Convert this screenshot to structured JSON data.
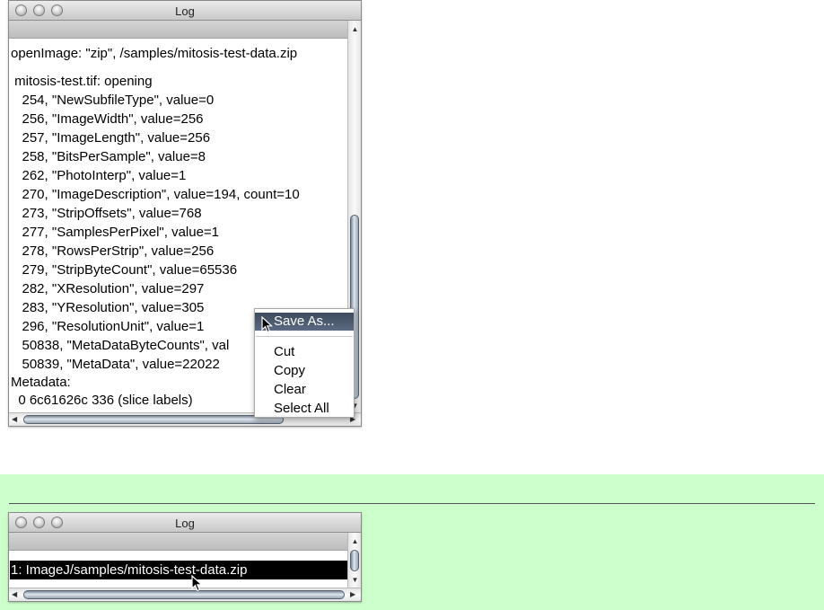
{
  "window1": {
    "title": "Log",
    "lines": [
      "openImage: \"zip\", /samples/mitosis-test-data.zip",
      "",
      " mitosis-test.tif: opening",
      "   254, \"NewSubfileType\", value=0",
      "   256, \"ImageWidth\", value=256",
      "   257, \"ImageLength\", value=256",
      "   258, \"BitsPerSample\", value=8",
      "   262, \"PhotoInterp\", value=1",
      "   270, \"ImageDescription\", value=194, count=10",
      "   273, \"StripOffsets\", value=768",
      "   277, \"SamplesPerPixel\", value=1",
      "   278, \"RowsPerStrip\", value=256",
      "   279, \"StripByteCount\", value=65536",
      "   282, \"XResolution\", value=297",
      "   283, \"YResolution\", value=305",
      "   296, \"ResolutionUnit\", value=1",
      "   50838, \"MetaDataByteCounts\", val",
      "   50839, \"MetaData\", value=22022",
      "Metadata:",
      "  0 6c61626c 336 (slice labels)"
    ]
  },
  "context_menu": {
    "items": [
      {
        "label": "Save As...",
        "selected": true
      },
      {
        "label": "Cut",
        "selected": false
      },
      {
        "label": "Copy",
        "selected": false
      },
      {
        "label": "Clear",
        "selected": false
      },
      {
        "label": "Select All",
        "selected": false
      }
    ]
  },
  "window2": {
    "title": "Log",
    "selected_line": "1: ImageJ/samples/mitosis-test-data.zip"
  },
  "colors": {
    "green_band": "#ccffcc",
    "menu_highlight": "#4a5870",
    "selection": "#000000"
  }
}
